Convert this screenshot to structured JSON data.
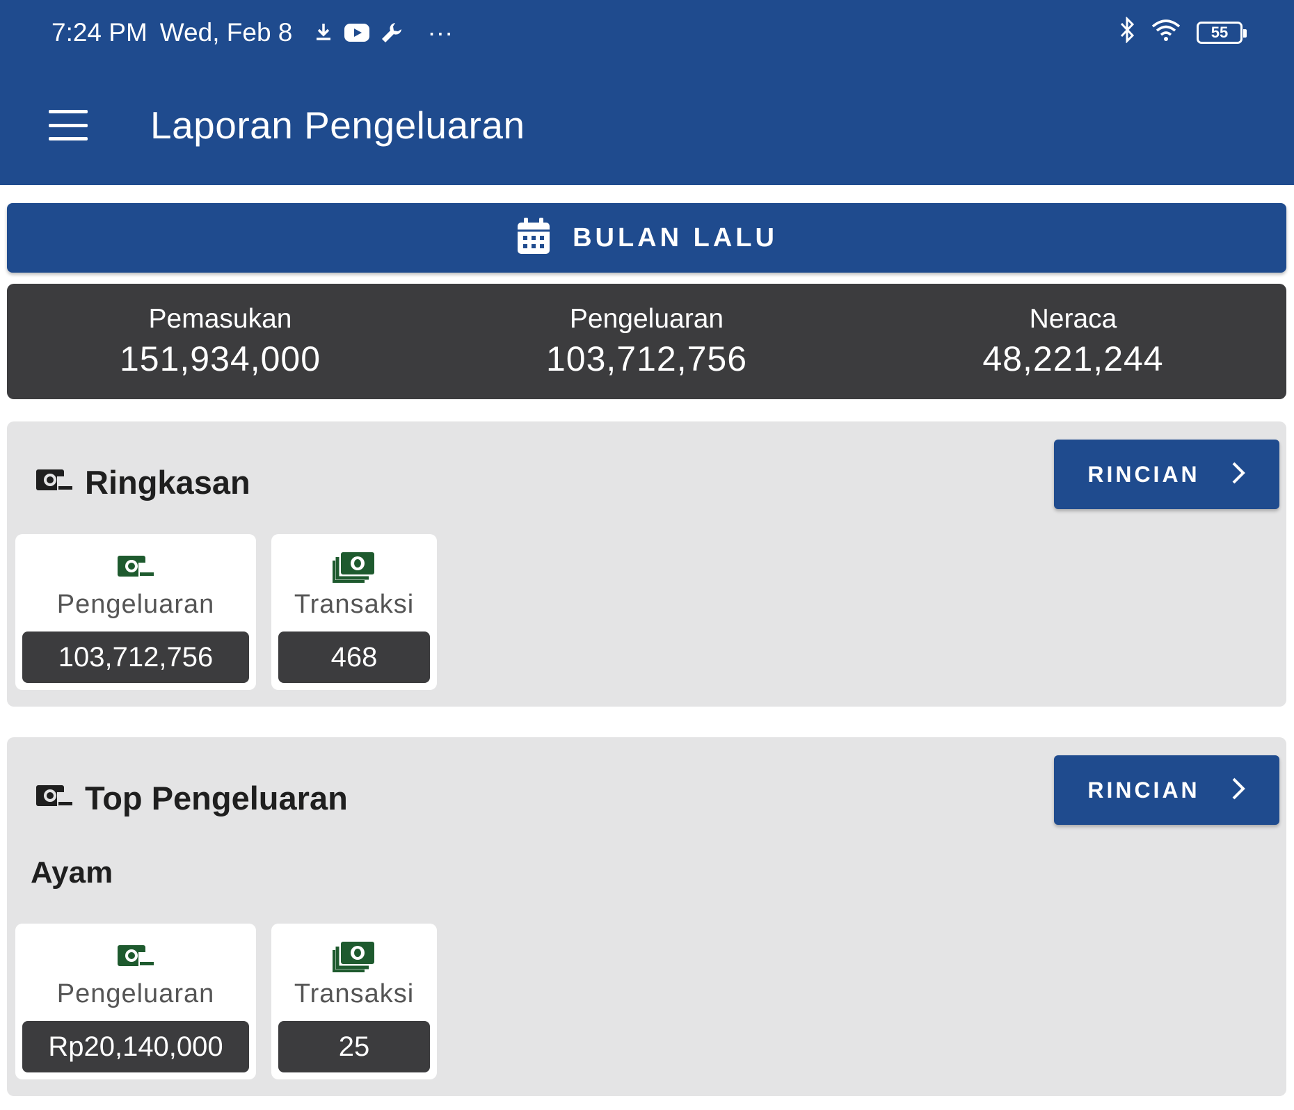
{
  "status_bar": {
    "time": "7:24 PM",
    "date": "Wed, Feb 8",
    "more": "···",
    "battery": "55"
  },
  "app_bar": {
    "title": "Laporan Pengeluaran"
  },
  "period": {
    "label": "BULAN LALU"
  },
  "summary": {
    "income_label": "Pemasukan",
    "income_value": "151,934,000",
    "expense_label": "Pengeluaran",
    "expense_value": "103,712,756",
    "balance_label": "Neraca",
    "balance_value": "48,221,244"
  },
  "ringkasan": {
    "title": "Ringkasan",
    "detail_label": "RINCIAN",
    "expense_label": "Pengeluaran",
    "expense_value": "103,712,756",
    "transactions_label": "Transaksi",
    "transactions_value": "468"
  },
  "top_expense": {
    "title": "Top Pengeluaran",
    "detail_label": "RINCIAN",
    "category": "Ayam",
    "expense_label": "Pengeluaran",
    "expense_value": "Rp20,140,000",
    "transactions_label": "Transaksi",
    "transactions_value": "25"
  },
  "colors": {
    "primary": "#1f4b8e",
    "dark": "#3c3c3e",
    "card_bg": "#e4e4e5",
    "icon_green": "#1e5a2e"
  }
}
